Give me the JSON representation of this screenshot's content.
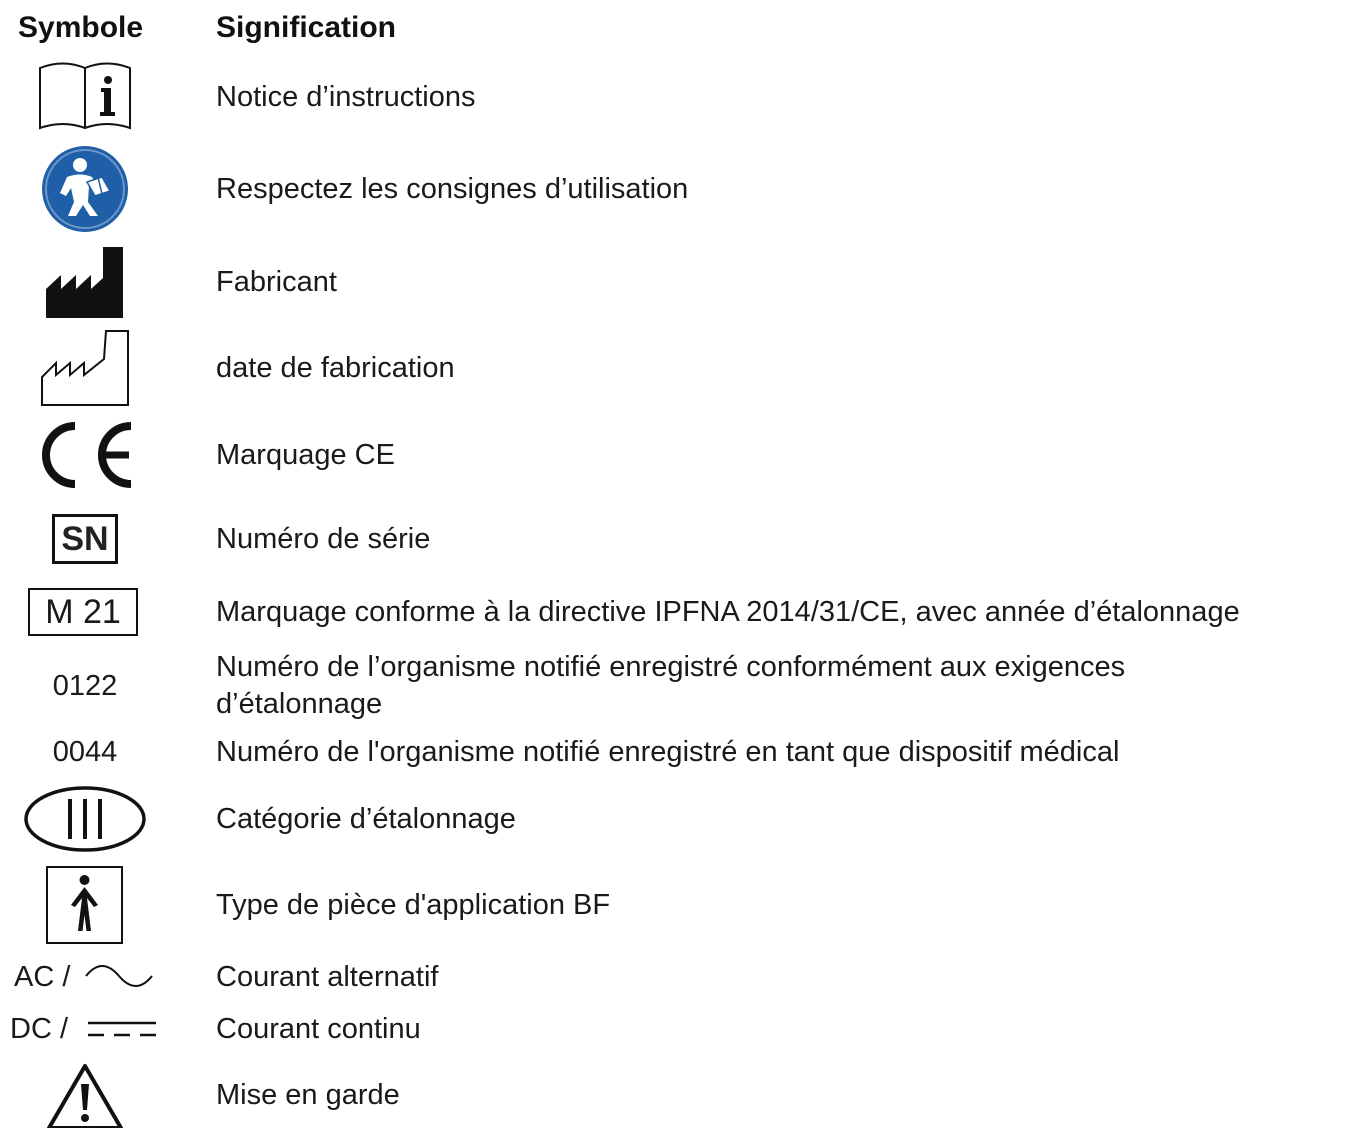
{
  "header": {
    "symbol_label": "Symbole",
    "meaning_label": "Signification"
  },
  "rows": [
    {
      "icon": "instructions-book-icon",
      "meaning": "Notice d’instructions"
    },
    {
      "icon": "follow-instructions-icon",
      "meaning": "Respectez les consignes d’utilisation"
    },
    {
      "icon": "manufacturer-icon",
      "meaning": "Fabricant"
    },
    {
      "icon": "manufacture-date-icon",
      "meaning": "date de fabrication"
    },
    {
      "icon": "ce-mark-icon",
      "meaning": "Marquage CE"
    },
    {
      "icon": "serial-number-icon",
      "symbol_text": "SN",
      "meaning": "Numéro de série"
    },
    {
      "icon": "metrology-mark-icon",
      "symbol_text": "M 21",
      "meaning": "Marquage conforme à la directive IPFNA 2014/31/CE, avec année d’étalonnage"
    },
    {
      "symbol_text": "0122",
      "meaning": "Numéro de l’organisme notifié enregistré conformément aux exigences\nd’étalonnage"
    },
    {
      "symbol_text": "0044",
      "meaning": "Numéro de l'organisme notifié enregistré en tant que dispositif médical"
    },
    {
      "icon": "accuracy-class-icon",
      "meaning": "Catégorie d’étalonnage"
    },
    {
      "icon": "bf-applied-part-icon",
      "meaning": "Type de pièce d'application BF"
    },
    {
      "icon": "alternating-current-icon",
      "symbol_text": "AC /",
      "meaning": "Courant alternatif"
    },
    {
      "icon": "direct-current-icon",
      "symbol_text": "DC /",
      "meaning": "Courant continu"
    },
    {
      "icon": "warning-icon",
      "meaning": "Mise en garde"
    }
  ],
  "colors": {
    "text": "#1a1a1a",
    "info_blue": "#1f5fa8"
  }
}
